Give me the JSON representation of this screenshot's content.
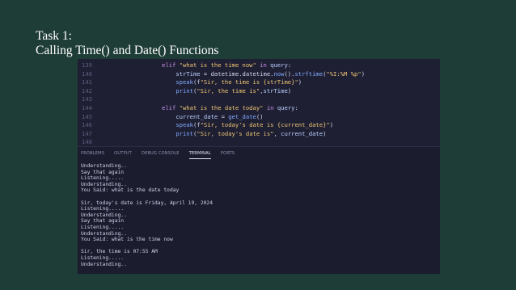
{
  "slide": {
    "title_line1": "Task 1:",
    "title_line2": "Calling Time() and Date() Functions"
  },
  "editor": {
    "lines": [
      {
        "num": "139",
        "parts": [
          [
            "kw",
            "elif "
          ],
          [
            "str",
            "\"what is the time now\""
          ],
          [
            "kw",
            " in "
          ],
          [
            "var",
            "query"
          ],
          [
            "txt",
            ":"
          ]
        ]
      },
      {
        "num": "140",
        "parts": [
          [
            "txt",
            "    "
          ],
          [
            "var",
            "strTime"
          ],
          [
            "txt",
            " = datetime.datetime."
          ],
          [
            "fn",
            "now"
          ],
          [
            "txt",
            "()."
          ],
          [
            "fn",
            "strftime"
          ],
          [
            "txt",
            "("
          ],
          [
            "str",
            "\"%I:%M %p\""
          ],
          [
            "txt",
            ")"
          ]
        ]
      },
      {
        "num": "141",
        "parts": [
          [
            "txt",
            "    "
          ],
          [
            "fn",
            "speak"
          ],
          [
            "txt",
            "(f"
          ],
          [
            "str",
            "\"Sir, the time is {strTime}\""
          ],
          [
            "txt",
            ")"
          ]
        ]
      },
      {
        "num": "142",
        "parts": [
          [
            "txt",
            "    "
          ],
          [
            "fn",
            "print"
          ],
          [
            "txt",
            "("
          ],
          [
            "str",
            "\"Sir, the time is\""
          ],
          [
            "txt",
            ","
          ],
          [
            "var",
            "strTime"
          ],
          [
            "txt",
            ")"
          ]
        ]
      },
      {
        "num": "143",
        "parts": []
      },
      {
        "num": "144",
        "parts": [
          [
            "kw",
            "elif "
          ],
          [
            "str",
            "\"what is the date today\""
          ],
          [
            "kw",
            " in "
          ],
          [
            "var",
            "query"
          ],
          [
            "txt",
            ":"
          ]
        ]
      },
      {
        "num": "145",
        "parts": [
          [
            "txt",
            "    "
          ],
          [
            "var",
            "current_date"
          ],
          [
            "txt",
            " = "
          ],
          [
            "fn",
            "get_date"
          ],
          [
            "txt",
            "()"
          ]
        ]
      },
      {
        "num": "146",
        "parts": [
          [
            "txt",
            "    "
          ],
          [
            "fn",
            "speak"
          ],
          [
            "txt",
            "(f"
          ],
          [
            "str",
            "\"Sir, today's date is {current_date}\""
          ],
          [
            "txt",
            ")"
          ]
        ]
      },
      {
        "num": "147",
        "parts": [
          [
            "txt",
            "    "
          ],
          [
            "fn",
            "print"
          ],
          [
            "txt",
            "("
          ],
          [
            "str",
            "\"Sir, today's date is\""
          ],
          [
            "txt",
            ", "
          ],
          [
            "var",
            "current_date"
          ],
          [
            "txt",
            ")"
          ]
        ]
      },
      {
        "num": "148",
        "parts": []
      }
    ]
  },
  "panel": {
    "tabs": [
      "PROBLEMS",
      "OUTPUT",
      "DEBUG CONSOLE",
      "TERMINAL",
      "PORTS"
    ],
    "active_tab": 3,
    "terminal_lines": [
      "Understanding..",
      "Say that again",
      "Listening.....",
      "Understanding..",
      "You Said: what is the date today",
      "",
      "Sir, today's date is Friday, April 19, 2024",
      "Listening.....",
      "Understanding..",
      "Say that again",
      "Listening.....",
      "Understanding..",
      "You Said: what is the time now",
      "",
      "Sir, the time is 07:55 AM",
      "Listening.....",
      "Understanding.."
    ]
  }
}
